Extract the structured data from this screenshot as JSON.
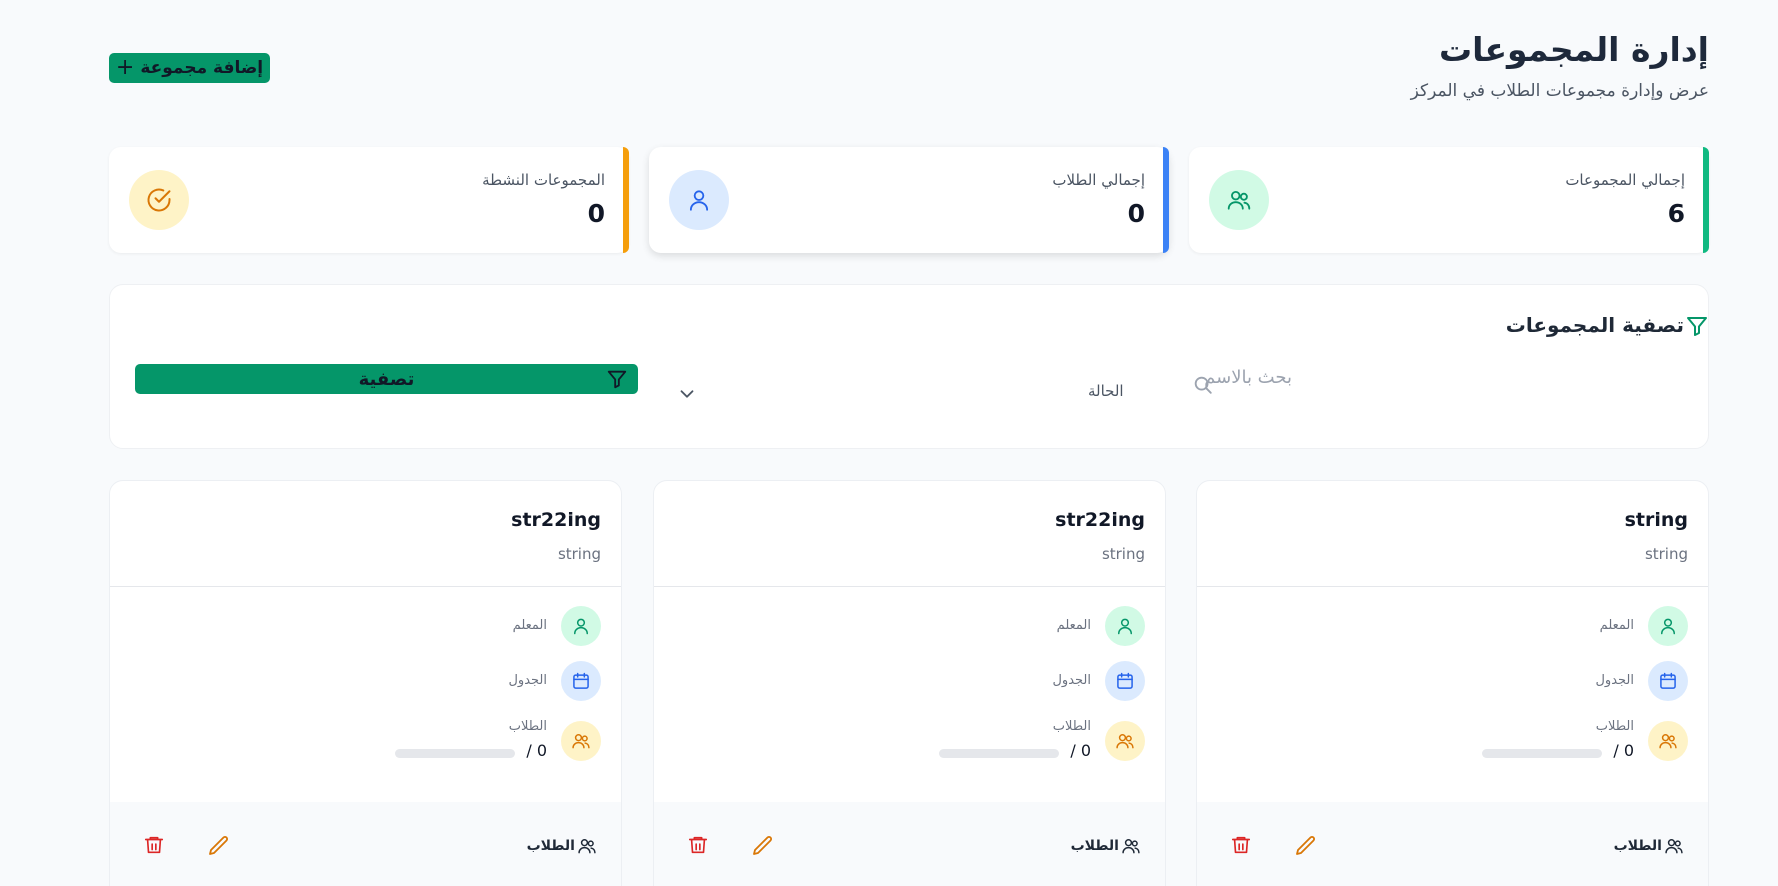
{
  "header": {
    "title": "إدارة المجموعات",
    "subtitle": "عرض وإدارة مجموعات الطلاب في المركز",
    "add_button_label": "إضافة مجموعة"
  },
  "stats": [
    {
      "label": "إجمالي المجموعات",
      "value": "6",
      "icon": "users-icon",
      "accent": "#10b981",
      "bg": "#d1fae5"
    },
    {
      "label": "إجمالي الطلاب",
      "value": "0",
      "icon": "user-icon",
      "accent": "#3b82f6",
      "bg": "#dbeafe"
    },
    {
      "label": "المجموعات النشطة",
      "value": "0",
      "icon": "check-circle-icon",
      "accent": "#f59e0b",
      "bg": "#fef3c7"
    }
  ],
  "filter": {
    "title": "تصفية المجموعات",
    "search_placeholder": "بحث بالاسم",
    "status_label": "الحالة",
    "button_label": "تصفية"
  },
  "groups": [
    {
      "name": "string",
      "description": "string",
      "teacher_label": "المعلم",
      "schedule_label": "الجدول",
      "students_label": "الطلاب",
      "students_count": "0 /",
      "capacity_fill": 0,
      "students_button": "الطلاب"
    },
    {
      "name": "str22ing",
      "description": "string",
      "teacher_label": "المعلم",
      "schedule_label": "الجدول",
      "students_label": "الطلاب",
      "students_count": "0 /",
      "capacity_fill": 0,
      "students_button": "الطلاب"
    },
    {
      "name": "str22ing",
      "description": "string",
      "teacher_label": "المعلم",
      "schedule_label": "الجدول",
      "students_label": "الطلاب",
      "students_count": "0 /",
      "capacity_fill": 0,
      "students_button": "الطلاب"
    }
  ],
  "colors": {
    "primary": "#059669",
    "teacher_bg": "#d1fae5",
    "schedule_bg": "#dbeafe",
    "students_bg": "#fef3c7",
    "edit": "#d97706",
    "delete": "#dc2626"
  }
}
